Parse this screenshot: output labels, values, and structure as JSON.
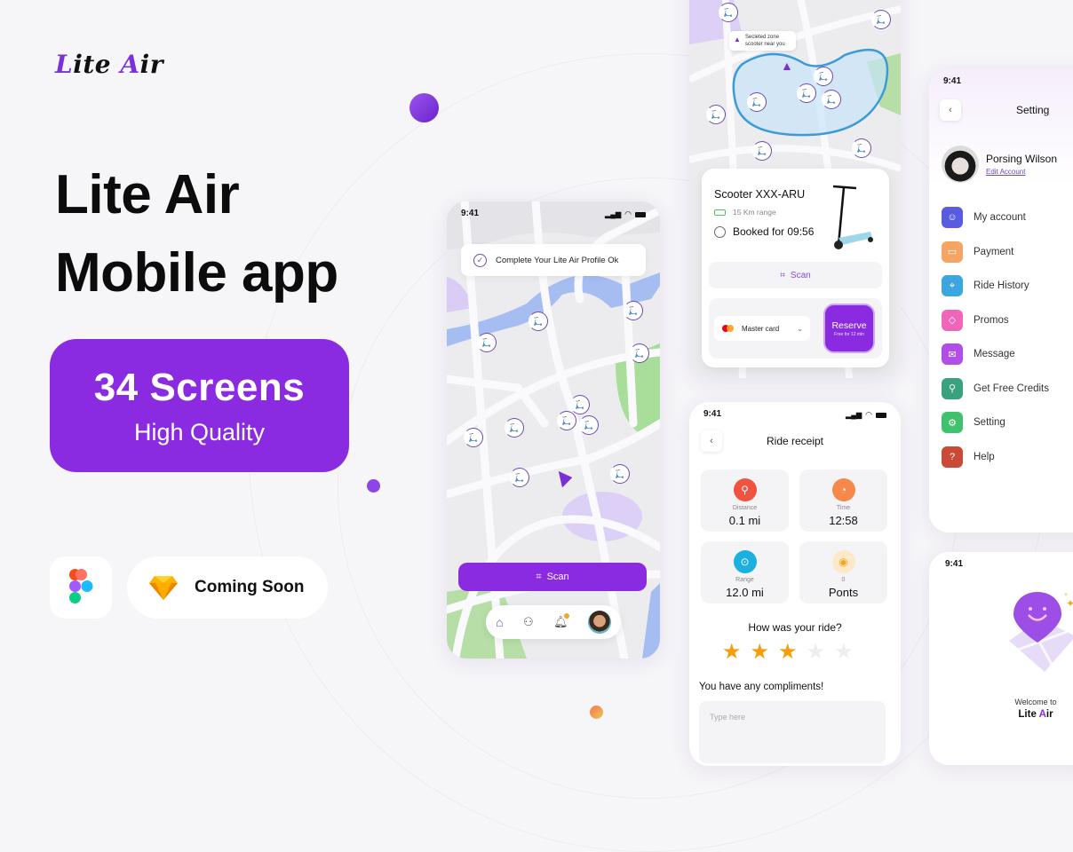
{
  "brand": {
    "logo_part1": "Lite ",
    "logo_part2": "A",
    "logo_part3": "ir",
    "accent_color": "#8a2be2"
  },
  "hero": {
    "line1": "Lite Air",
    "line2": "Mobile app"
  },
  "badge": {
    "title": "34 Screens",
    "subtitle": "High Quality"
  },
  "tools": {
    "figma_icon": "figma-icon",
    "sketch_icon": "sketch-icon",
    "sketch_label": "Coming Soon"
  },
  "map_screen": {
    "time": "9:41",
    "toast": "Complete Your Lite Air Profile Ok",
    "scan_label": "Scan",
    "nav": [
      "home-icon",
      "users-icon",
      "bell-icon",
      "avatar"
    ]
  },
  "booking_screen": {
    "zone_tooltip_line1": "Secleted zone",
    "zone_tooltip_line2": "scooter near you",
    "scooter_name": "Scooter XXX-ARU",
    "range": "15 Km range",
    "booked": "Booked for 09:56",
    "scan_label": "Scan",
    "payment_method": "Master card",
    "reserve_label": "Reserve",
    "reserve_sub": "Free for 12 min"
  },
  "receipt_screen": {
    "time": "9:41",
    "title": "Ride receipt",
    "stats": [
      {
        "label": "Distance",
        "value": "0.1 mi",
        "color": "#f0533f"
      },
      {
        "label": "Time",
        "value": "12:58",
        "color": "#f6894a"
      },
      {
        "label": "Range",
        "value": "12.0 mi",
        "color": "#1bb0e0"
      },
      {
        "label": "0",
        "value": "Ponts",
        "color": "#f5a623"
      }
    ],
    "rating_question": "How was your ride?",
    "rating": 3,
    "rating_max": 5,
    "compliments_label": "You have any compliments!",
    "compliments_placeholder": "Type here"
  },
  "settings_screen": {
    "time": "9:41",
    "title": "Setting",
    "user_name": "Porsing Wilson",
    "edit_account": "Edit Account",
    "items": [
      {
        "label": "My account",
        "icon": "user-icon",
        "color": "#5a5ce0"
      },
      {
        "label": "Payment",
        "icon": "card-icon",
        "color": "#f4a463"
      },
      {
        "label": "Ride History",
        "icon": "map-icon",
        "color": "#3ba6e0"
      },
      {
        "label": "Promos",
        "icon": "ticket-icon",
        "color": "#ef66b8"
      },
      {
        "label": "Message",
        "icon": "mail-icon",
        "color": "#b04ee6"
      },
      {
        "label": "Get Free Credits",
        "icon": "location-icon",
        "color": "#3aa17f"
      },
      {
        "label": "Setting",
        "icon": "gear-icon",
        "color": "#3fc16d"
      },
      {
        "label": "Help",
        "icon": "help-icon",
        "color": "#c94a37"
      }
    ]
  },
  "welcome_screen": {
    "time": "9:41",
    "welcome": "Welcome to",
    "app_part1": "Lite ",
    "app_part2": "A",
    "app_part3": "ir"
  }
}
